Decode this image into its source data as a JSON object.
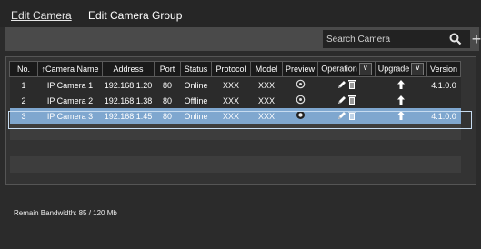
{
  "tabs": {
    "edit_camera": "Edit Camera",
    "edit_camera_group": "Edit Camera Group"
  },
  "toolbar": {
    "search_placeholder": "Search Camera"
  },
  "icons": {
    "search": "search-icon",
    "add": "plus-icon",
    "preview": "preview-circle-icon",
    "edit": "pencil-icon",
    "delete": "trash-icon",
    "upgrade": "arrow-up-icon",
    "dropdown": "chevron-down-icon"
  },
  "table": {
    "headers": {
      "no": "No.",
      "camera_name": "↑Camera Name",
      "address": "Address",
      "port": "Port",
      "status": "Status",
      "protocol": "Protocol",
      "model": "Model",
      "preview": "Preview",
      "operation": "Operation",
      "upgrade": "Upgrade",
      "version": "Version"
    },
    "rows": [
      {
        "no": "1",
        "name": "IP Camera 1",
        "address": "192.168.1.20",
        "port": "80",
        "status": "Online",
        "protocol": "XXX",
        "model": "XXX",
        "version": "4.1.0.0"
      },
      {
        "no": "2",
        "name": "IP Camera 2",
        "address": "192.168.1.38",
        "port": "80",
        "status": "Offline",
        "protocol": "XXX",
        "model": "XXX",
        "version": ""
      },
      {
        "no": "3",
        "name": "IP Camera 3",
        "address": "192.168.1.45",
        "port": "80",
        "status": "Online",
        "protocol": "XXX",
        "model": "XXX",
        "version": "4.1.0.0"
      }
    ]
  },
  "footer": {
    "bandwidth": "Remain Bandwidth: 85 / 120 Mb"
  },
  "colors": {
    "selected_row": "#7fa7cf",
    "header_bg": "#1a1a1a",
    "panel_bg": "#333333"
  }
}
